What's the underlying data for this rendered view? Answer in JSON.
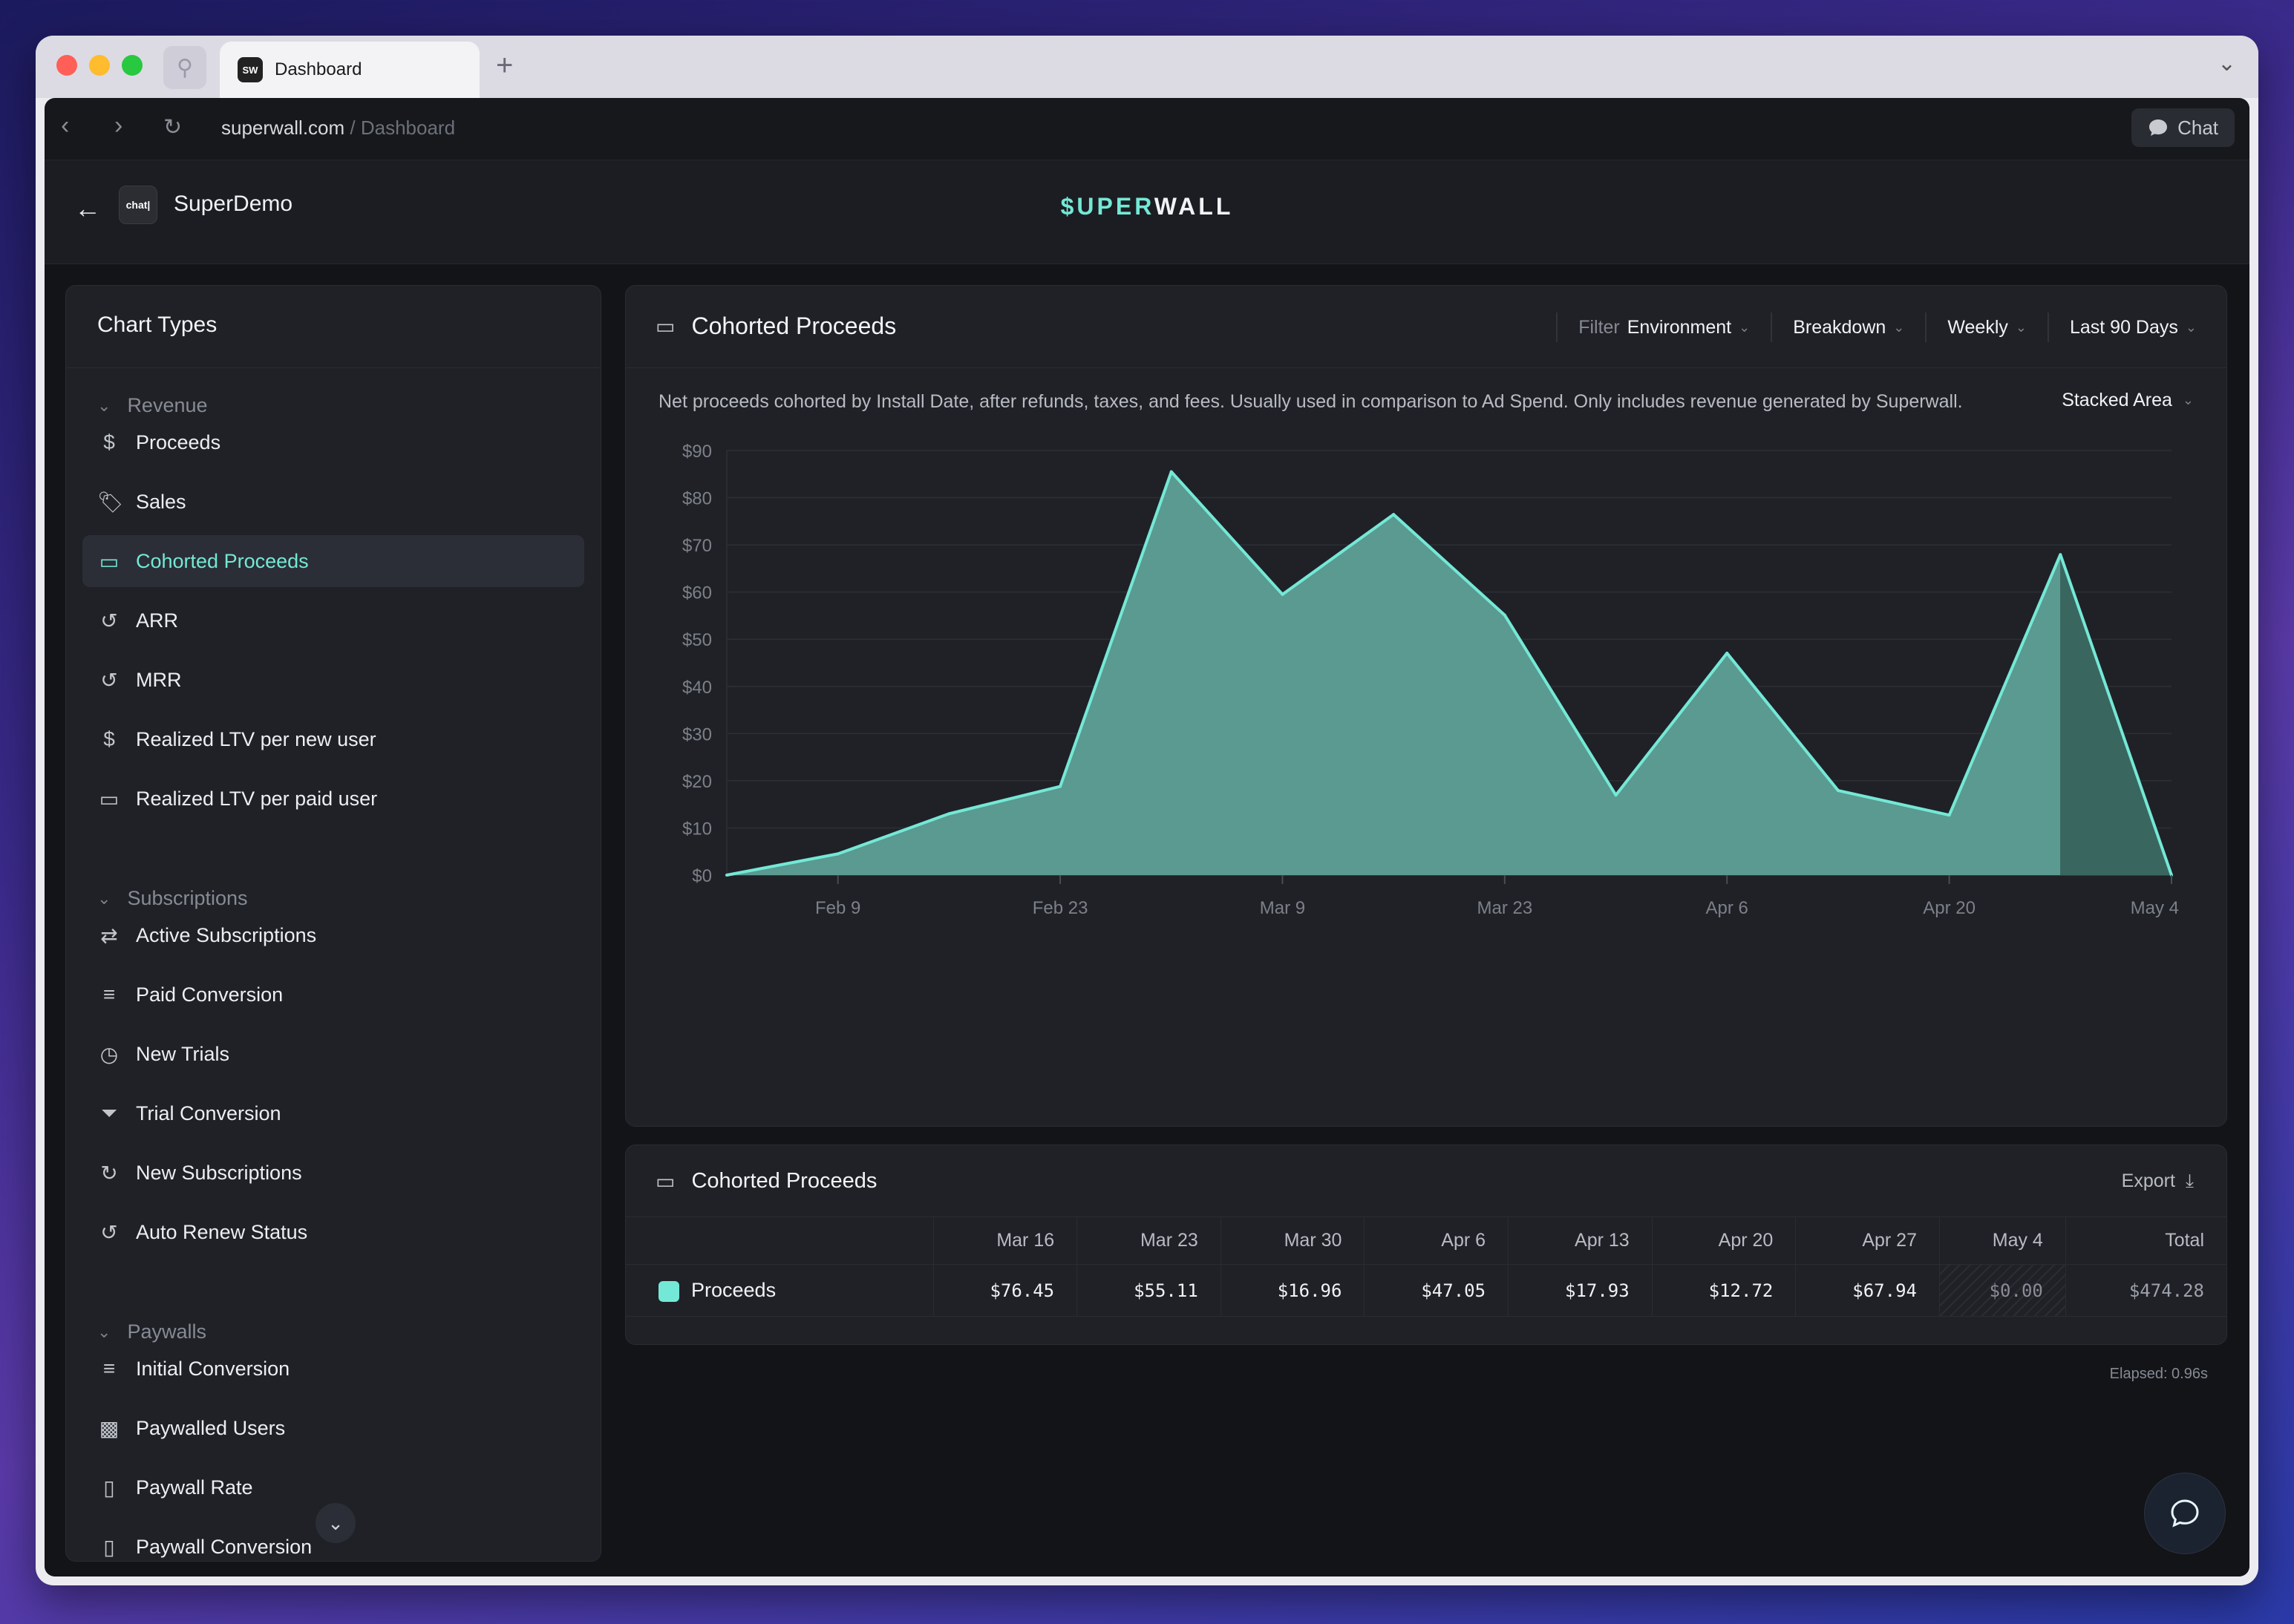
{
  "browser": {
    "tab_title": "Dashboard",
    "tab_favicon": "SW",
    "url_host": "superwall.com",
    "url_path": " / Dashboard",
    "chat_label": "Chat"
  },
  "header": {
    "app_icon_text": "chat|",
    "app_name": "SuperDemo",
    "brand_accent": "$UPER",
    "brand_rest": "WALL"
  },
  "sidebar": {
    "title": "Chart Types",
    "sections": [
      {
        "label": "Revenue",
        "items": [
          "Proceeds",
          "Sales",
          "Cohorted Proceeds",
          "ARR",
          "MRR",
          "Realized LTV per new user",
          "Realized LTV per paid user"
        ]
      },
      {
        "label": "Subscriptions",
        "items": [
          "Active Subscriptions",
          "Paid Conversion",
          "New Trials",
          "Trial Conversion",
          "New Subscriptions",
          "Auto Renew Status"
        ]
      },
      {
        "label": "Paywalls",
        "items": [
          "Initial Conversion",
          "Paywalled Users",
          "Paywall Rate",
          "Paywall Conversion"
        ]
      }
    ],
    "active_item": "Cohorted Proceeds"
  },
  "chart_panel": {
    "title": "Cohorted Proceeds",
    "filter_label": "Filter",
    "filter_value": "Environment",
    "breakdown_label": "Breakdown",
    "interval_label": "Weekly",
    "range_label": "Last 90 Days",
    "description": "Net proceeds cohorted by Install Date, after refunds, taxes, and fees. Usually used in comparison to Ad Spend. Only includes revenue generated by Superwall.",
    "chart_type_label": "Stacked Area"
  },
  "chart_data": {
    "type": "area",
    "title": "",
    "ylim": [
      0,
      90
    ],
    "yticks": [
      0,
      10,
      20,
      30,
      40,
      50,
      60,
      70,
      80,
      90
    ],
    "ytick_labels": [
      "$0",
      "$10",
      "$20",
      "$30",
      "$40",
      "$50",
      "$60",
      "$70",
      "$80",
      "$90"
    ],
    "xtick_labels": [
      "Feb 9",
      "Feb 23",
      "Mar 9",
      "Mar 23",
      "Apr 6",
      "Apr 20",
      "May 4"
    ],
    "x": [
      "Feb 2",
      "Feb 9",
      "Feb 16",
      "Feb 23",
      "Mar 2",
      "Mar 9",
      "Mar 16",
      "Mar 23",
      "Mar 30",
      "Apr 6",
      "Apr 13",
      "Apr 20",
      "Apr 27",
      "May 4"
    ],
    "series": [
      {
        "name": "Proceeds",
        "values": [
          0,
          4.5,
          13,
          18.8,
          85.5,
          59.5,
          76.45,
          55.11,
          16.96,
          47.05,
          17.93,
          12.72,
          67.94,
          0
        ]
      }
    ],
    "incomplete_from": "Apr 27",
    "grid": true,
    "line_color": "#74e8d6",
    "fill_color": "#5a9a90",
    "incomplete_fill_color": "#3a6660"
  },
  "table": {
    "title": "Cohorted Proceeds",
    "export_label": "Export",
    "columns": [
      "Mar 16",
      "Mar 23",
      "Mar 30",
      "Apr 6",
      "Apr 13",
      "Apr 20",
      "Apr 27",
      "May 4",
      "Total"
    ],
    "rows": [
      {
        "label": "Proceeds",
        "values": [
          "$76.45",
          "$55.11",
          "$16.96",
          "$47.05",
          "$17.93",
          "$12.72",
          "$67.94",
          "$0.00",
          "$474.28"
        ]
      }
    ]
  },
  "elapsed": "Elapsed: 0.96s",
  "colors": {
    "accent": "#74e8d6",
    "bg": "#131418",
    "panel": "#1f2126"
  }
}
